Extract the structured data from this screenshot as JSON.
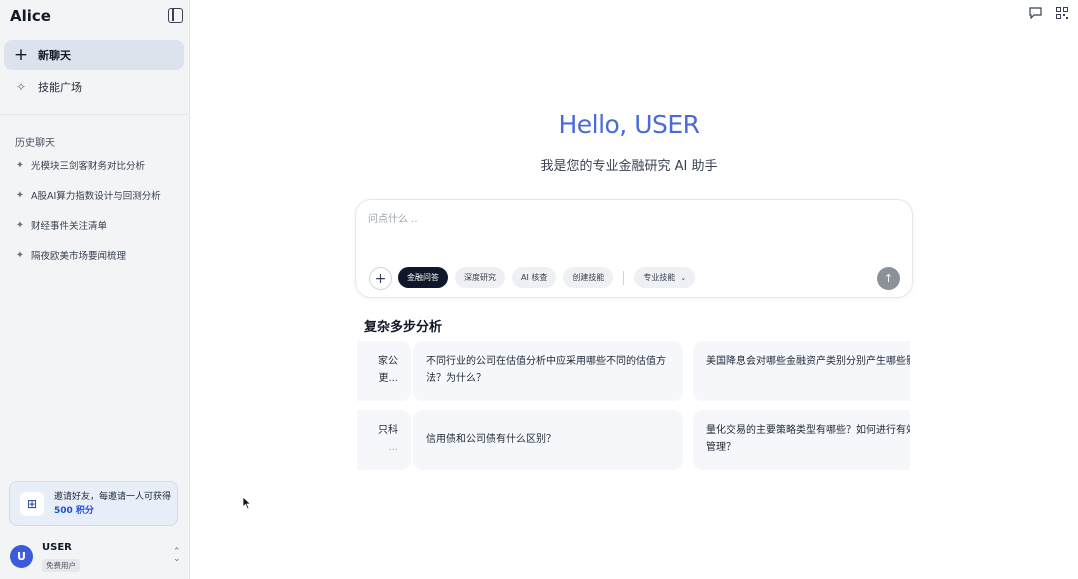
{
  "sidebar": {
    "brand": "Alice",
    "new_chat_label": "新聊天",
    "skills_label": "技能广场",
    "history_title": "历史聊天",
    "history_items": [
      "光模块三剑客财务对比分析",
      "A股AI算力指数设计与回测分析",
      "财经事件关注清单",
      "隔夜欧美市场要闻梳理"
    ],
    "invite_text": "邀请好友，每邀请一人可获得",
    "invite_points": "500 积分",
    "user_name": "USER",
    "user_initial": "U",
    "user_plan": "免费用户"
  },
  "main": {
    "greeting": "Hello, USER",
    "subtitle": "我是您的专业金融研究 AI 助手",
    "input_placeholder": "问点什么 ..",
    "modes": [
      "金融问答",
      "深度研究",
      "AI 核查",
      "创建技能"
    ],
    "skills_dropdown": "专业技能",
    "section_title": "复杂多步分析",
    "cards": [
      {
        "text": "家公",
        "text2": "更..."
      },
      {
        "text": "不同行业的公司在估值分析中应采用哪些不同的估值方法？为什么？"
      },
      {
        "text": "美国降息会对哪些金融资产类别分别产生哪些影响？"
      },
      {
        "text": "只科",
        "text2": "..."
      },
      {
        "text": "信用债和公司债有什么区别？"
      },
      {
        "text": "量化交易的主要策略类型有哪些？如何进行有效的风险管理？"
      }
    ]
  },
  "colors": {
    "accent": "#4a6bd6",
    "sidebar_bg": "#f3f4f6",
    "active_chip": "#0f172a"
  }
}
